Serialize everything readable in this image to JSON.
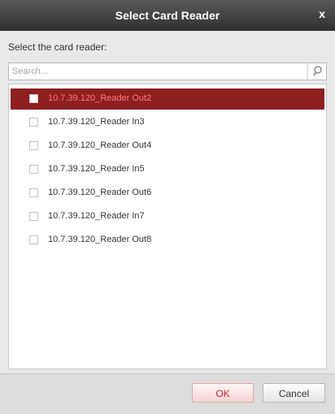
{
  "dialog": {
    "title": "Select Card Reader",
    "close": "x"
  },
  "prompt": "Select the card reader:",
  "search": {
    "placeholder": "Search..."
  },
  "readers": [
    {
      "label": "10.7.39.120_Reader Out2",
      "selected": true
    },
    {
      "label": "10.7.39.120_Reader In3"
    },
    {
      "label": "10.7.39.120_Reader Out4"
    },
    {
      "label": "10.7.39.120_Reader In5"
    },
    {
      "label": "10.7.39.120_Reader Out6"
    },
    {
      "label": "10.7.39.120_Reader In7"
    },
    {
      "label": "10.7.39.120_Reader Out8"
    }
  ],
  "buttons": {
    "ok": "OK",
    "cancel": "Cancel"
  },
  "colors": {
    "titlebar": "#3c3c3c",
    "selection": "#8e1f1f",
    "ok_text": "#cc2424"
  }
}
